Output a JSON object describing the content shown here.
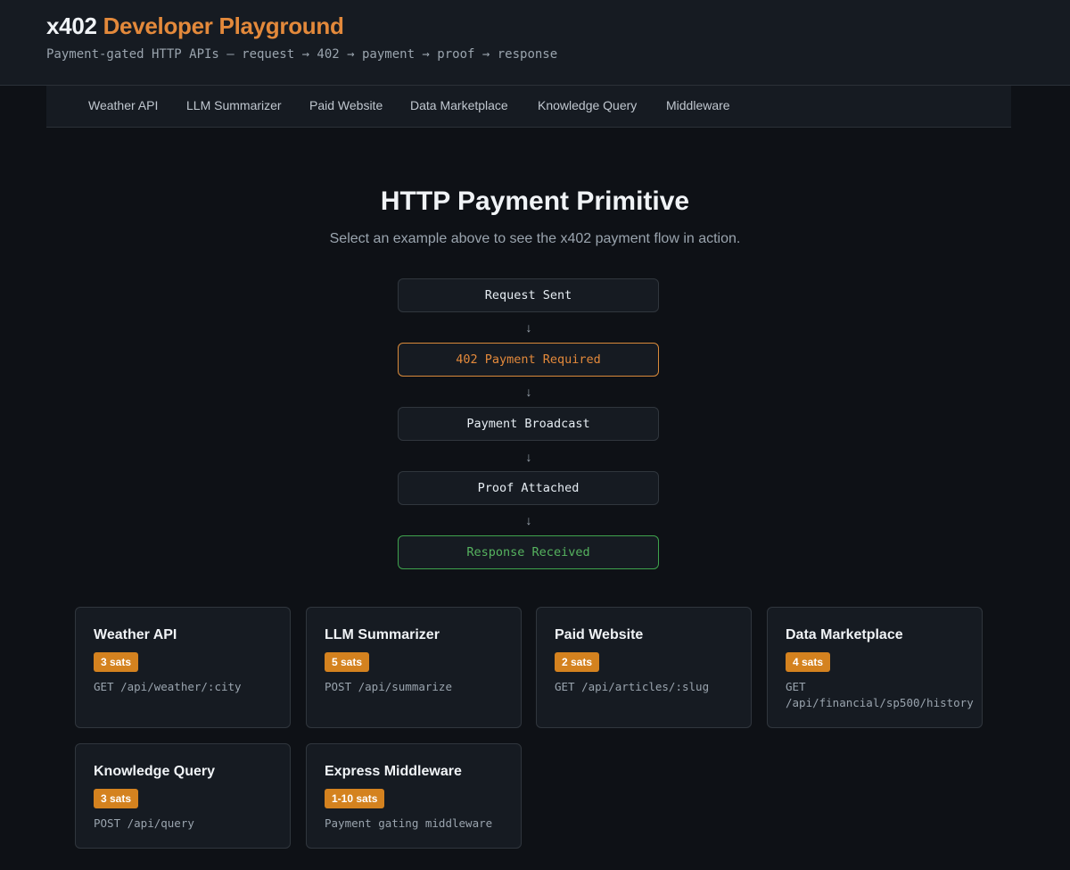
{
  "header": {
    "title_brand": "x402",
    "title_accent": "Developer Playground",
    "subtitle": "Payment-gated HTTP APIs — request → 402 → payment → proof → response"
  },
  "nav": {
    "items": [
      {
        "label": "Weather API"
      },
      {
        "label": "LLM Summarizer"
      },
      {
        "label": "Paid Website"
      },
      {
        "label": "Data Marketplace"
      },
      {
        "label": "Knowledge Query"
      },
      {
        "label": "Middleware"
      }
    ]
  },
  "hero": {
    "title": "HTTP Payment Primitive",
    "subtitle": "Select an example above to see the x402 payment flow in action."
  },
  "flow": {
    "arrow": "↓",
    "steps": [
      {
        "label": "Request Sent",
        "status": "neutral"
      },
      {
        "label": "402 Payment Required",
        "status": "warning"
      },
      {
        "label": "Payment Broadcast",
        "status": "neutral"
      },
      {
        "label": "Proof Attached",
        "status": "neutral"
      },
      {
        "label": "Response Received",
        "status": "success"
      }
    ]
  },
  "cards": [
    {
      "title": "Weather API",
      "price": "3 sats",
      "endpoint": "GET /api/weather/:city"
    },
    {
      "title": "LLM Summarizer",
      "price": "5 sats",
      "endpoint": "POST /api/summarize"
    },
    {
      "title": "Paid Website",
      "price": "2 sats",
      "endpoint": "GET /api/articles/:slug"
    },
    {
      "title": "Data Marketplace",
      "price": "4 sats",
      "endpoint": "GET /api/financial/sp500/history"
    },
    {
      "title": "Knowledge Query",
      "price": "3 sats",
      "endpoint": "POST /api/query"
    },
    {
      "title": "Express Middleware",
      "price": "1-10 sats",
      "endpoint": "Payment gating middleware"
    }
  ],
  "colors": {
    "background": "#0e1116",
    "surface": "#161b22",
    "border": "#30363d",
    "accent": "#e3893b",
    "price_badge": "#d4821f",
    "success": "#56b35f"
  }
}
